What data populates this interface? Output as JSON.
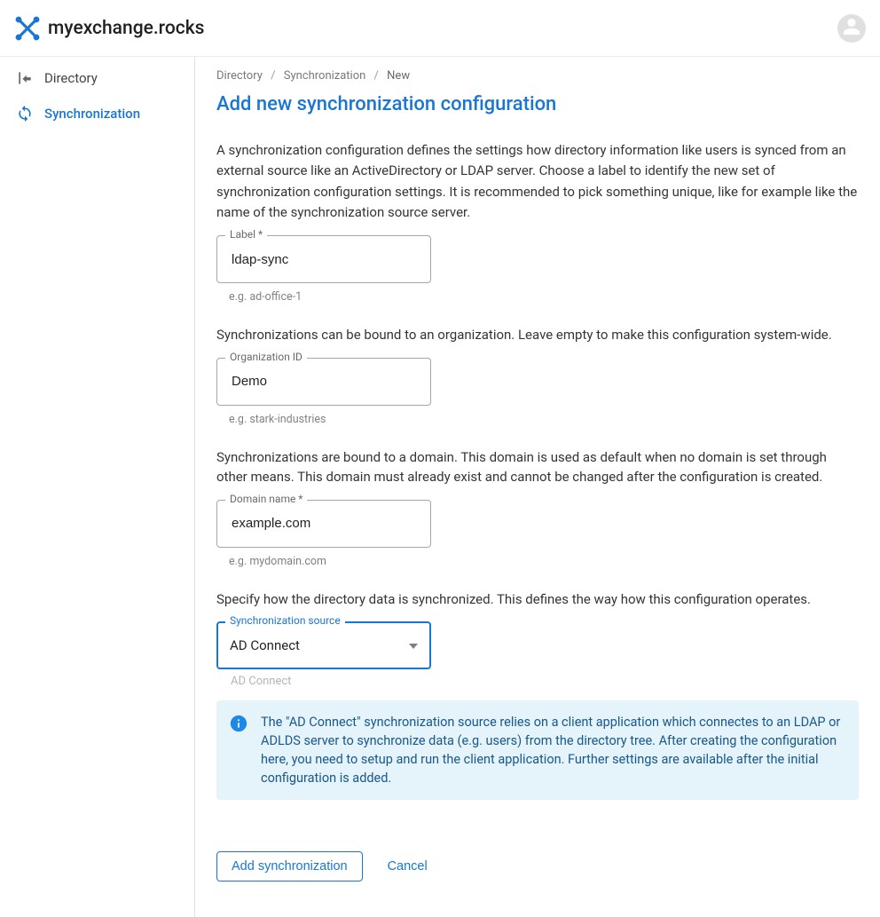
{
  "header": {
    "brand": "myexchange.rocks"
  },
  "sidebar": {
    "items": [
      {
        "label": "Directory",
        "icon": "back-parent-icon",
        "active": false
      },
      {
        "label": "Synchronization",
        "icon": "sync-users-icon",
        "active": true
      }
    ]
  },
  "breadcrumb": {
    "items": [
      "Directory",
      "Synchronization",
      "New"
    ]
  },
  "page": {
    "title": "Add new synchronization configuration",
    "intro": "A synchronization configuration defines the settings how directory information like users is synced from an external source like an ActiveDirectory or LDAP server. Choose a label to identify the new set of synchronization configuration settings. It is recommended to pick something unique, like for example like the name of the synchronization source server.",
    "org_text": "Synchronizations can be bound to an organization. Leave empty to make this configuration system-wide.",
    "domain_text": "Synchronizations are bound to a domain. This domain is used as default when no domain is set through other means. This domain must already exist and cannot be changed after the configuration is created.",
    "source_text": "Specify how the directory data is synchronized. This defines the way how this configuration operates."
  },
  "fields": {
    "label": {
      "label": "Label *",
      "value": "ldap-sync",
      "hint": "e.g. ad-office-1"
    },
    "org": {
      "label": "Organization ID",
      "value": "Demo",
      "hint": "e.g. stark-industries"
    },
    "domain": {
      "label": "Domain name *",
      "value": "example.com",
      "hint": "e.g. mydomain.com"
    },
    "source": {
      "label": "Synchronization source",
      "value": "AD Connect",
      "below_hint": "AD Connect"
    }
  },
  "info": {
    "text": "The \"AD Connect\" synchronization source relies on a client application which connectes to an LDAP or ADLDS server to synchronize data (e.g. users) from the directory tree. After creating the configuration here, you need to setup and run the client application. Further settings are available after the initial configuration is added."
  },
  "actions": {
    "primary": "Add synchronization",
    "cancel": "Cancel"
  }
}
